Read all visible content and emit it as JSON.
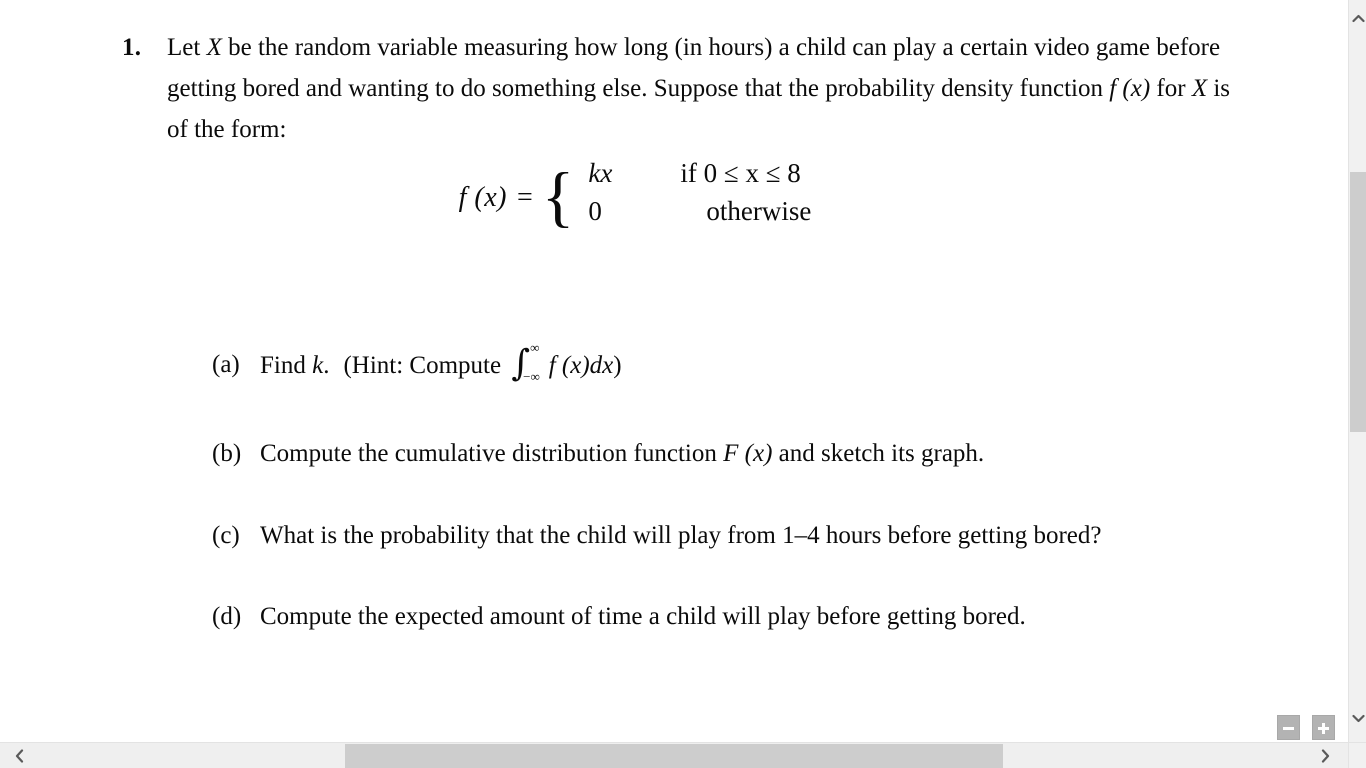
{
  "document": {
    "problem": {
      "number": "1.",
      "stem_parts": {
        "t1": "Let ",
        "var1": "X",
        "t2": " be the random variable measuring how long (in hours) a child can play a certain video game before getting bored and wanting to do something else. Suppose that the probability density function ",
        "fx": "f (x)",
        "t3": " for ",
        "var2": "X",
        "t4": " is of the form:"
      },
      "equation": {
        "lhs": "f (x)",
        "equals": "=",
        "brace": "{",
        "case1_value": "kx",
        "case1_condition": "if 0 ≤ x ≤ 8",
        "case2_value": "0",
        "case2_condition": "otherwise"
      },
      "parts": [
        {
          "label": "(a)",
          "text_before": "Find ",
          "symbol": "k",
          "text_after": ".",
          "hint_open": "(Hint: Compute ",
          "integral_upper": "∞",
          "integral_lower": "−∞",
          "integral_body": "f (x)dx",
          "hint_close": ")"
        },
        {
          "label": "(b)",
          "text_before": "Compute the cumulative distribution function ",
          "symbol": "F (x)",
          "text_after": " and sketch its graph."
        },
        {
          "label": "(c)",
          "text": "What is the probability that the child will play from 1–4 hours before getting bored?"
        },
        {
          "label": "(d)",
          "text": "Compute the expected amount of time a child will play before getting bored."
        }
      ]
    }
  },
  "viewer_controls": {
    "zoom_out_label": "−",
    "zoom_in_label": "+",
    "scroll_up_glyph": "⌃",
    "scroll_down_glyph": "⌄",
    "scroll_left_glyph": "‹",
    "scroll_right_glyph": "›"
  },
  "colors": {
    "page_background": "#ffffff",
    "text": "#0b0b0b",
    "scrollbar_track": "#f1f1f1",
    "scrollbar_thumb": "#cdcdcd",
    "zoom_button": "#b3b3b3",
    "zoom_glyph": "#ffffff"
  }
}
